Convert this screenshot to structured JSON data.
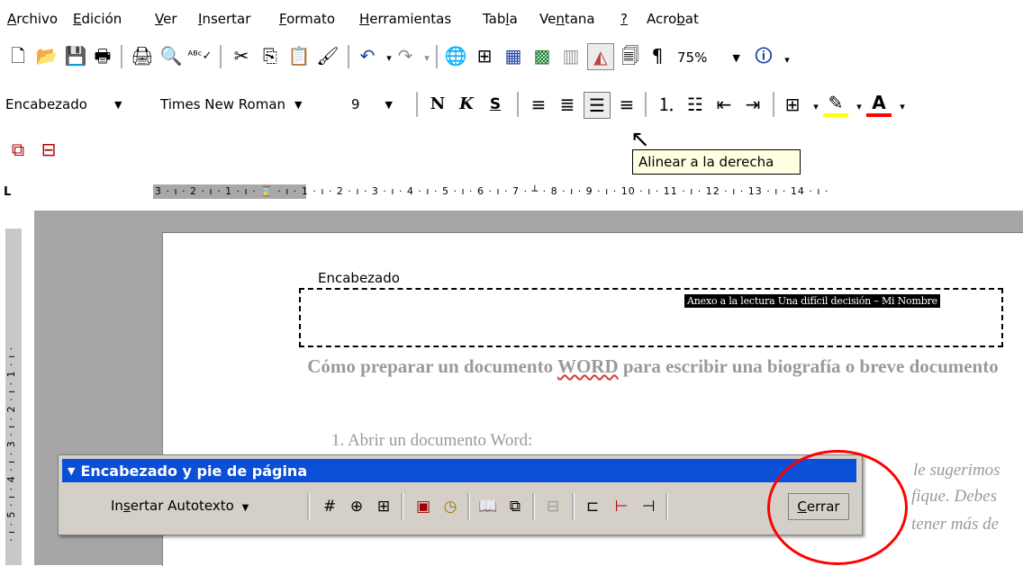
{
  "menu": [
    {
      "key": "archivo",
      "accel": "A",
      "rest": "rchivo"
    },
    {
      "key": "edicion",
      "accel": "E",
      "rest": "dición"
    },
    {
      "key": "ver",
      "accel": "V",
      "rest": "er"
    },
    {
      "key": "insertar",
      "accel": "I",
      "rest": "nsertar"
    },
    {
      "key": "formato",
      "accel": "F",
      "rest": "ormato"
    },
    {
      "key": "herramientas",
      "accel": "H",
      "rest": "erramientas"
    },
    {
      "key": "tabla",
      "pre": "Tab",
      "accel": "l",
      "rest": "a"
    },
    {
      "key": "ventana",
      "pre": "Ve",
      "accel": "n",
      "rest": "tana"
    },
    {
      "key": "ayuda",
      "accel": "?",
      "rest": ""
    },
    {
      "key": "acrobat",
      "pre": "Acro",
      "accel": "b",
      "rest": "at"
    }
  ],
  "standard_toolbar": {
    "zoom": "75%"
  },
  "format_toolbar": {
    "style": "Encabezado",
    "font": "Times New Roman",
    "size": "9",
    "bold": "N",
    "italic": "K",
    "underline": "S"
  },
  "tooltip": "Alinear a la derecha",
  "ruler": {
    "horizontal": "3 · ı · 2 · ı · 1 · ı · ⌛ · ı · 1 · ı · 2 · ı · 3 · ı · 4 · ı · 5 · ı · 6 · ı · 7 · ┴ · 8 · ı · 9 · ı · 10 · ı · 11 · ı · 12 · ı · 13 · ı · 14 · ı ·",
    "vertical": "· ı · 5 · ı · 4 · ı · 3 · ı · 2 · ı · 1 · ı ·"
  },
  "document": {
    "header_label": "Encabezado",
    "header_text": "Anexo a la lectura  Una difícil decisión – Mi Nombre",
    "title_part1": "Cómo preparar un documento ",
    "title_word": "WORD",
    "title_part2": " para escribir una biografía o breve documento",
    "item1": "1.  Abrir un documento Word:",
    "ghost1": "le sugerimos",
    "ghost2": "fique. Debes",
    "ghost3": "tener más de"
  },
  "header_footer_toolbar": {
    "title": "Encabezado y pie de página",
    "autotext_pre": "In",
    "autotext_accel": "s",
    "autotext_rest": "ertar Autotexto",
    "close_accel": "C",
    "close_rest": "errar"
  },
  "annotation_color": "#ff0000"
}
